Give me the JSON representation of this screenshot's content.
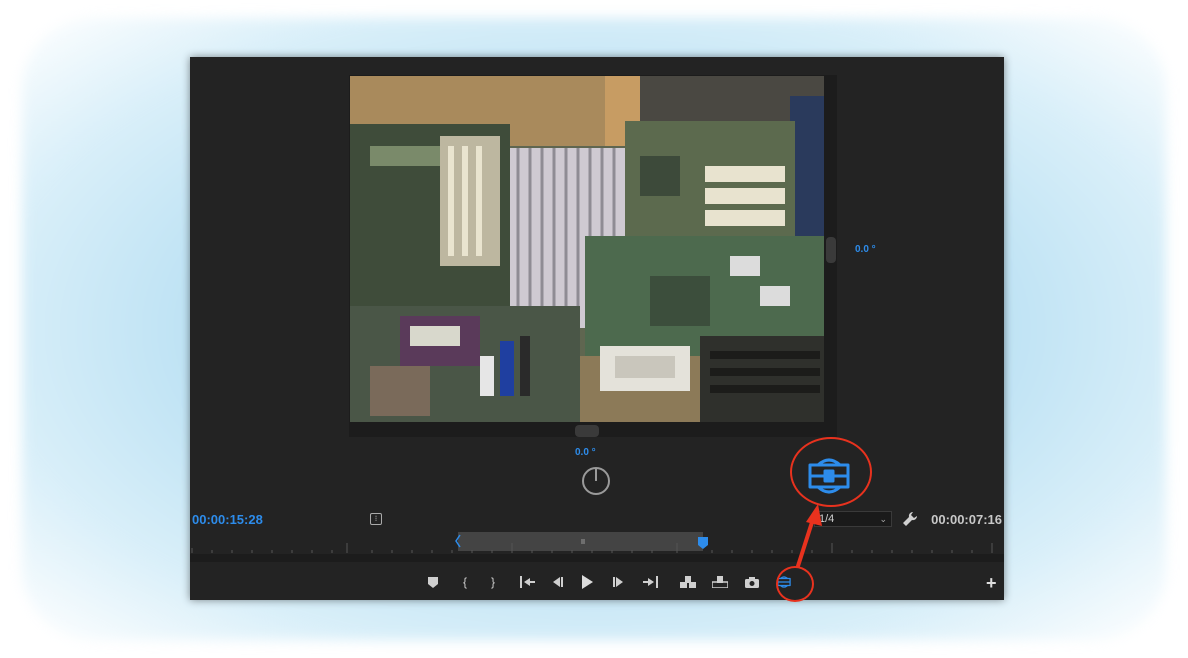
{
  "monitor": {
    "angle_vertical": "0.0 °",
    "angle_horizontal": "0.0 °",
    "timecode_current": "00:00:15:28",
    "timecode_duration": "00:00:07:16",
    "resolution": {
      "selected": "1/4"
    }
  },
  "icons": {
    "settings": "settings-icon",
    "wrench": "wrench-icon",
    "vr_video_toggle": "vr-video-icon",
    "add": "plus-icon"
  },
  "transport": {
    "buttons": [
      {
        "name": "add-marker-button",
        "icon": "marker-icon",
        "glyph": "⬟"
      },
      {
        "name": "mark-in-button",
        "icon": "mark-in-icon",
        "glyph": "{"
      },
      {
        "name": "mark-out-button",
        "icon": "mark-out-icon",
        "glyph": "}"
      },
      {
        "name": "go-to-in-button",
        "icon": "go-to-in-icon",
        "glyph": "{←"
      },
      {
        "name": "step-back-button",
        "icon": "step-back-icon",
        "glyph": "◀|"
      },
      {
        "name": "play-button",
        "icon": "play-icon",
        "glyph": "▶"
      },
      {
        "name": "step-forward-button",
        "icon": "step-forward-icon",
        "glyph": "|▶"
      },
      {
        "name": "go-to-out-button",
        "icon": "go-to-out-icon",
        "glyph": "→}"
      },
      {
        "name": "insert-button",
        "icon": "insert-icon",
        "glyph": "⊞"
      },
      {
        "name": "overwrite-button",
        "icon": "overwrite-icon",
        "glyph": "⊟"
      },
      {
        "name": "export-frame-button",
        "icon": "camera-icon",
        "glyph": "◙"
      }
    ],
    "plus_glyph": "+"
  },
  "annotation": {
    "color": "#e8321e"
  },
  "colors": {
    "accent": "#2d8ceb",
    "panel_bg": "#232323"
  }
}
